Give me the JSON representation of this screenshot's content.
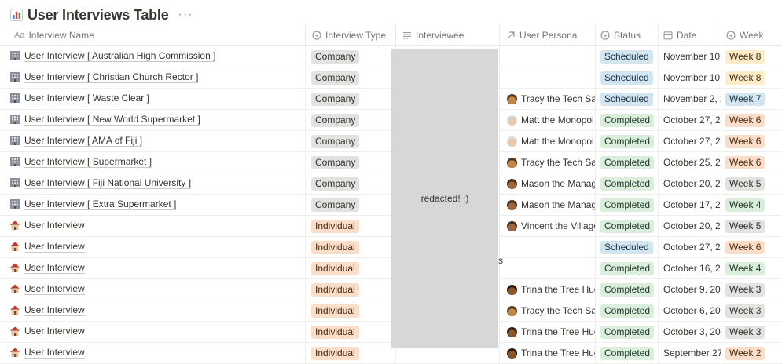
{
  "page": {
    "title": "User Interviews Table",
    "title_icon": "bar-chart-icon",
    "more": "···"
  },
  "columns": {
    "name": {
      "label": "Interview Name",
      "icon": "text-type-icon"
    },
    "type": {
      "label": "Interview Type",
      "icon": "select-icon"
    },
    "interviewee": {
      "label": "Interviewee",
      "icon": "text-lines-icon"
    },
    "persona": {
      "label": "User Persona",
      "icon": "relation-arrow-icon"
    },
    "status": {
      "label": "Status",
      "icon": "select-icon"
    },
    "date": {
      "label": "Date",
      "icon": "calendar-icon"
    },
    "week": {
      "label": "Week",
      "icon": "select-icon"
    }
  },
  "redacted_label": "redacted! :)",
  "interviewee_fragment": "s",
  "rows": [
    {
      "icon": "office-building-icon",
      "name": "User Interview [ Australian High Commission ]",
      "type": "Company",
      "persona": "",
      "persona_icon": "",
      "status": "Scheduled",
      "date": "November 10,",
      "week": "Week 8"
    },
    {
      "icon": "office-building-icon",
      "name": "User Interview [ Christian Church Rector ]",
      "type": "Company",
      "persona": "",
      "persona_icon": "",
      "status": "Scheduled",
      "date": "November 10,",
      "week": "Week 8"
    },
    {
      "icon": "office-building-icon",
      "name": "User Interview [ Waste Clear ]",
      "type": "Company",
      "persona": "Tracy the Tech Sa",
      "persona_icon": "woman-avatar-icon",
      "status": "Scheduled",
      "date": "November 2, 2",
      "week": "Week 7"
    },
    {
      "icon": "office-building-icon",
      "name": "User Interview [ New World Supermarket ]",
      "type": "Company",
      "persona": "Matt the Monopol",
      "persona_icon": "old-man-avatar-icon",
      "status": "Completed",
      "date": "October 27, 2",
      "week": "Week 6"
    },
    {
      "icon": "office-building-icon",
      "name": "User Interview [ AMA of Fiji ]",
      "type": "Company",
      "persona": "Matt the Monopol",
      "persona_icon": "old-man-avatar-icon",
      "status": "Completed",
      "date": "October 27, 2",
      "week": "Week 6"
    },
    {
      "icon": "office-building-icon",
      "name": "User Interview [ Supermarket ]",
      "type": "Company",
      "persona": "Tracy the Tech Sa",
      "persona_icon": "woman-avatar-icon",
      "status": "Completed",
      "date": "October 25, 2",
      "week": "Week 6"
    },
    {
      "icon": "office-building-icon",
      "name": "User Interview [ Fiji National University ]",
      "type": "Company",
      "persona": "Mason the Manag",
      "persona_icon": "man-avatar-icon",
      "status": "Completed",
      "date": "October 20, 2",
      "week": "Week 5"
    },
    {
      "icon": "office-building-icon",
      "name": "User Interview [ Extra Supermarket ]",
      "type": "Company",
      "persona": "Mason the Manag",
      "persona_icon": "man-avatar-icon",
      "status": "Completed",
      "date": "October 17, 2",
      "week": "Week 4"
    },
    {
      "icon": "house-icon",
      "name": "User Interview",
      "type": "Individual",
      "persona": "Vincent the Village",
      "persona_icon": "man-avatar-icon",
      "status": "Completed",
      "date": "October 20, 2",
      "week": "Week 5"
    },
    {
      "icon": "house-icon",
      "name": "User Interview",
      "type": "Individual",
      "persona": "",
      "persona_icon": "",
      "status": "Scheduled",
      "date": "October 27, 2",
      "week": "Week 6"
    },
    {
      "icon": "house-icon",
      "name": "User Interview",
      "type": "Individual",
      "persona": "",
      "persona_icon": "",
      "status": "Completed",
      "date": "October 16, 2",
      "week": "Week 4"
    },
    {
      "icon": "house-icon",
      "name": "User Interview",
      "type": "Individual",
      "persona": "Trina the Tree Hug",
      "persona_icon": "dark-woman-avatar-icon",
      "status": "Completed",
      "date": "October 9, 20",
      "week": "Week 3"
    },
    {
      "icon": "house-icon",
      "name": "User Interview",
      "type": "Individual",
      "persona": "Tracy the Tech Sa",
      "persona_icon": "woman-avatar-icon",
      "status": "Completed",
      "date": "October 6, 20",
      "week": "Week 3"
    },
    {
      "icon": "house-icon",
      "name": "User Interview",
      "type": "Individual",
      "persona": "Trina the Tree Hug",
      "persona_icon": "dark-woman-avatar-icon",
      "status": "Completed",
      "date": "October 3, 20",
      "week": "Week 3"
    },
    {
      "icon": "house-icon",
      "name": "User Interview",
      "type": "Individual",
      "persona": "Trina the Tree Hug",
      "persona_icon": "dark-woman-avatar-icon",
      "status": "Completed",
      "date": "September 27",
      "week": "Week 2"
    }
  ]
}
